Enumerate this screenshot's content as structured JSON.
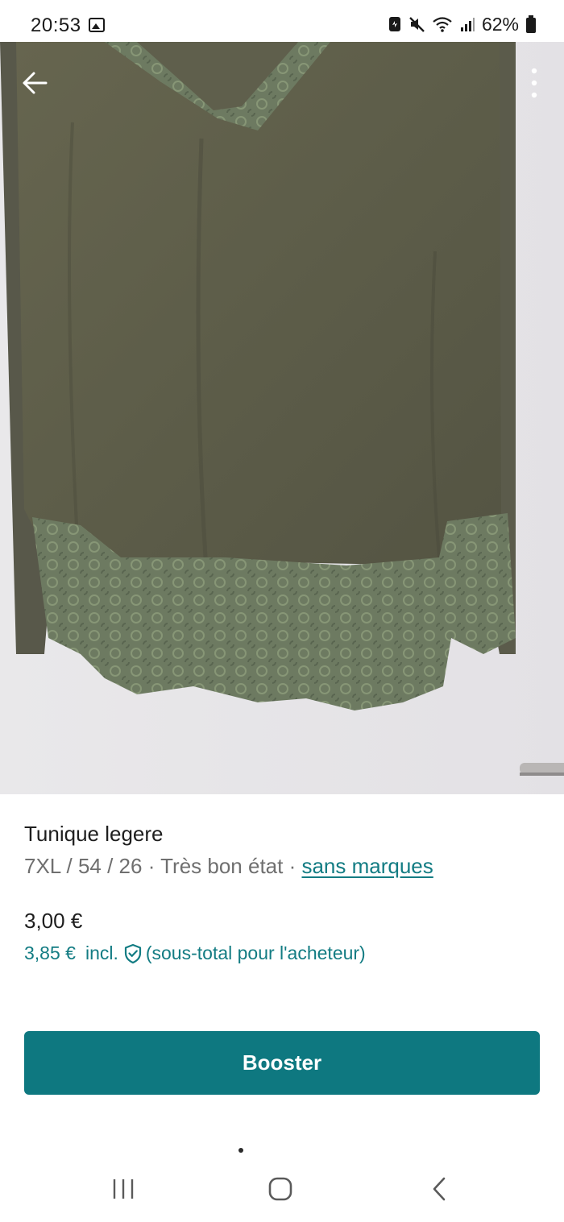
{
  "status_bar": {
    "time": "20:53",
    "battery_percent": "62%",
    "icons": [
      "gallery-icon",
      "data-saver-icon",
      "mute-icon",
      "wifi-icon",
      "signal-icon",
      "battery-icon"
    ]
  },
  "photo": {
    "subject": "olive green tunic with lace trim",
    "colors": {
      "wall": "#e7e6e8",
      "fabric": "#5f5f4c",
      "lace": "#6c7a60"
    }
  },
  "toolbar": {
    "back_icon": "arrow-left-icon",
    "more_icon": "more-vertical-icon"
  },
  "item": {
    "title": "Tunique legere",
    "size": "7XL / 54 / 26",
    "condition": "Très bon état",
    "separator": " · ",
    "brand": "sans marques",
    "price": "3,00 €",
    "price_incl": "3,85 €",
    "incl_label": "incl.",
    "incl_note": "(sous-total pour l'acheteur)"
  },
  "actions": {
    "booster_label": "Booster"
  },
  "colors": {
    "accent": "#0e7880",
    "link": "#137c83",
    "muted_text": "#6f6f6f"
  },
  "nav_bar": {
    "icons": [
      "recents-icon",
      "home-icon",
      "back-icon"
    ]
  }
}
